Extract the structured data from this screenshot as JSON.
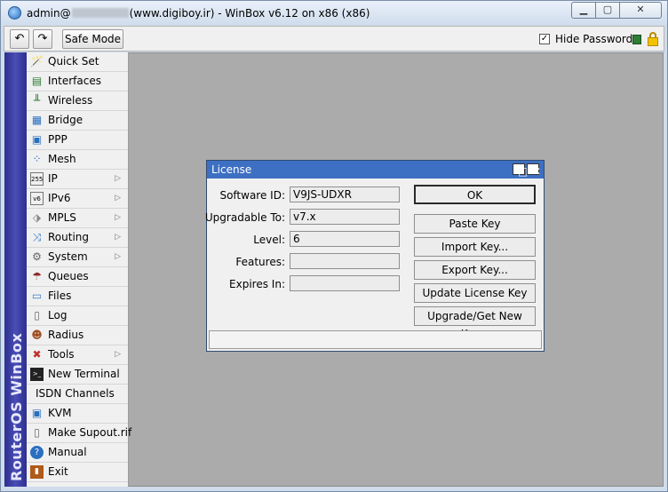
{
  "window": {
    "title_user": "admin@",
    "title_rest": "(www.digiboy.ir) - WinBox v6.12 on x86 (x86)",
    "min_icon": "minimize-icon",
    "max_icon": "maximize-icon",
    "close_icon": "close-icon"
  },
  "toolbar": {
    "undo_icon": "undo-icon",
    "redo_icon": "redo-icon",
    "safe_mode_label": "Safe Mode",
    "hide_passwords_label": "Hide Passwords",
    "hide_passwords_checked": true
  },
  "brand": {
    "text": "RouterOS WinBox"
  },
  "menu": {
    "items": [
      {
        "label": "Quick Set",
        "icon": "quick-set-icon",
        "has_submenu": false
      },
      {
        "label": "Interfaces",
        "icon": "interfaces-icon",
        "has_submenu": false
      },
      {
        "label": "Wireless",
        "icon": "wireless-icon",
        "has_submenu": false
      },
      {
        "label": "Bridge",
        "icon": "bridge-icon",
        "has_submenu": false
      },
      {
        "label": "PPP",
        "icon": "ppp-icon",
        "has_submenu": false
      },
      {
        "label": "Mesh",
        "icon": "mesh-icon",
        "has_submenu": false
      },
      {
        "label": "IP",
        "icon": "ip-icon",
        "has_submenu": true
      },
      {
        "label": "IPv6",
        "icon": "ipv6-icon",
        "has_submenu": true
      },
      {
        "label": "MPLS",
        "icon": "mpls-icon",
        "has_submenu": true
      },
      {
        "label": "Routing",
        "icon": "routing-icon",
        "has_submenu": true
      },
      {
        "label": "System",
        "icon": "system-gear-icon",
        "has_submenu": true
      },
      {
        "label": "Queues",
        "icon": "queues-icon",
        "has_submenu": false
      },
      {
        "label": "Files",
        "icon": "files-folder-icon",
        "has_submenu": false
      },
      {
        "label": "Log",
        "icon": "log-icon",
        "has_submenu": false
      },
      {
        "label": "Radius",
        "icon": "radius-icon",
        "has_submenu": false
      },
      {
        "label": "Tools",
        "icon": "tools-icon",
        "has_submenu": true
      },
      {
        "label": "New Terminal",
        "icon": "terminal-icon",
        "has_submenu": false
      },
      {
        "label": "ISDN Channels",
        "icon": "",
        "has_submenu": false
      },
      {
        "label": "KVM",
        "icon": "kvm-icon",
        "has_submenu": false
      },
      {
        "label": "Make Supout.rif",
        "icon": "supout-icon",
        "has_submenu": false
      },
      {
        "label": "Manual",
        "icon": "help-icon",
        "has_submenu": false
      },
      {
        "label": "Exit",
        "icon": "exit-door-icon",
        "has_submenu": false
      }
    ]
  },
  "license_dialog": {
    "title": "License",
    "fields": [
      {
        "label": "Software ID:",
        "value": "V9JS-UDXR"
      },
      {
        "label": "Upgradable To:",
        "value": "v7.x"
      },
      {
        "label": "Level:",
        "value": "6"
      },
      {
        "label": "Features:",
        "value": ""
      },
      {
        "label": "Expires In:",
        "value": ""
      }
    ],
    "buttons": {
      "ok": "OK",
      "paste_key": "Paste Key",
      "import_key": "Import Key...",
      "export_key": "Export Key...",
      "update_license_key": "Update License Key",
      "upgrade_get_new_key": "Upgrade/Get New Key..."
    },
    "status_text": ""
  },
  "colors": {
    "brand_bar": "#3a3ea6",
    "dialog_title": "#3d6fc2",
    "workspace": "#ababab"
  }
}
